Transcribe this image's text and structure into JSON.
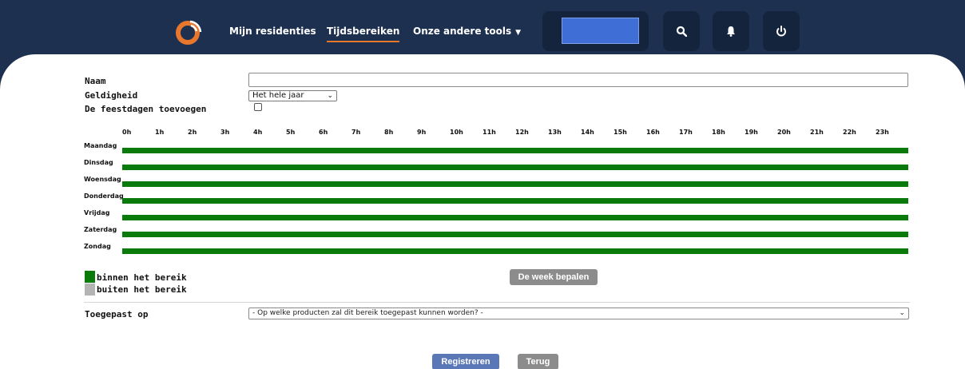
{
  "nav": {
    "links": [
      "Mijn residenties",
      "Tijdsbereiken",
      "Onze andere tools"
    ],
    "active": "Tijdsbereiken",
    "icons": [
      "logo-icon",
      "search-icon",
      "bell-icon",
      "power-icon"
    ],
    "accent": "#e8772e"
  },
  "form": {
    "name_label": "Naam",
    "name_value": "",
    "validity_label": "Geldigheid",
    "validity_selected": "Het hele jaar",
    "holidays_label": "De feestdagen toevoegen",
    "holidays_checked": false
  },
  "schedule": {
    "hours": [
      "0h",
      "1h",
      "2h",
      "3h",
      "4h",
      "5h",
      "6h",
      "7h",
      "8h",
      "9h",
      "10h",
      "11h",
      "12h",
      "13h",
      "14h",
      "15h",
      "16h",
      "17h",
      "18h",
      "19h",
      "20h",
      "21h",
      "22h",
      "23h"
    ],
    "days": [
      "Maandag",
      "Dinsdag",
      "Woensdag",
      "Donderdag",
      "Vrijdag",
      "Zaterdag",
      "Zondag"
    ],
    "in_range_fraction": [
      1,
      1,
      1,
      1,
      1,
      1,
      1
    ],
    "in_color": "#0a7a0a",
    "out_color": "#b4b4b4"
  },
  "legend": {
    "in_label": "binnen het bereik",
    "out_label": "buiten het bereik"
  },
  "buttons": {
    "week": "De week bepalen",
    "register": "Registreren",
    "back": "Terug"
  },
  "applied": {
    "label": "Toegepast op",
    "placeholder": "- Op welke producten zal dit bereik toegepast kunnen worden? -"
  }
}
